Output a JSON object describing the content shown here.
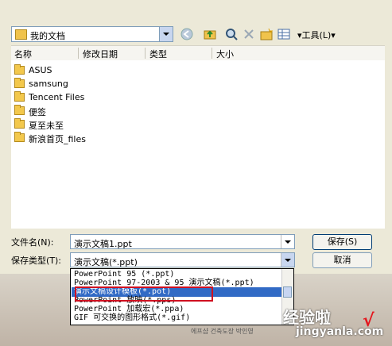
{
  "toolbar": {
    "location": "我的文档",
    "tools_label": "▾工具(L)▾"
  },
  "columns": [
    "名称",
    "修改日期",
    "类型",
    "大小"
  ],
  "files": [
    "ASUS",
    "samsung",
    "Tencent Files",
    "便签",
    "夏至未至",
    "新浪首页_files"
  ],
  "form": {
    "filename_label": "文件名(N):",
    "filename_value": "演示文稿1.ppt",
    "savetype_label": "保存类型(T):",
    "savetype_value": "演示文稿(*.ppt)",
    "save_button": "保存(S)",
    "cancel_button": "取消"
  },
  "type_options": [
    "PowerPoint 95 (*.ppt)",
    "PowerPoint 97-2003 & 95 演示文稿(*.ppt)",
    "演示文稿设计模板(*.pot)",
    "PowerPoint 放映(*.pps)",
    "PowerPoint 加载宏(*.ppa)",
    "GIF 可交换的图形格式(*.gif)"
  ],
  "selected_option_index": 2,
  "backdrop_text": "에프샵 건축도장 박인영",
  "watermark": {
    "line1": "经验啦",
    "line2": "jingyanla.com",
    "check": "√"
  },
  "colors": {
    "selection": "#316ac5",
    "highlight_box": "#d01020",
    "dialog_bg": "#ece9d8"
  }
}
